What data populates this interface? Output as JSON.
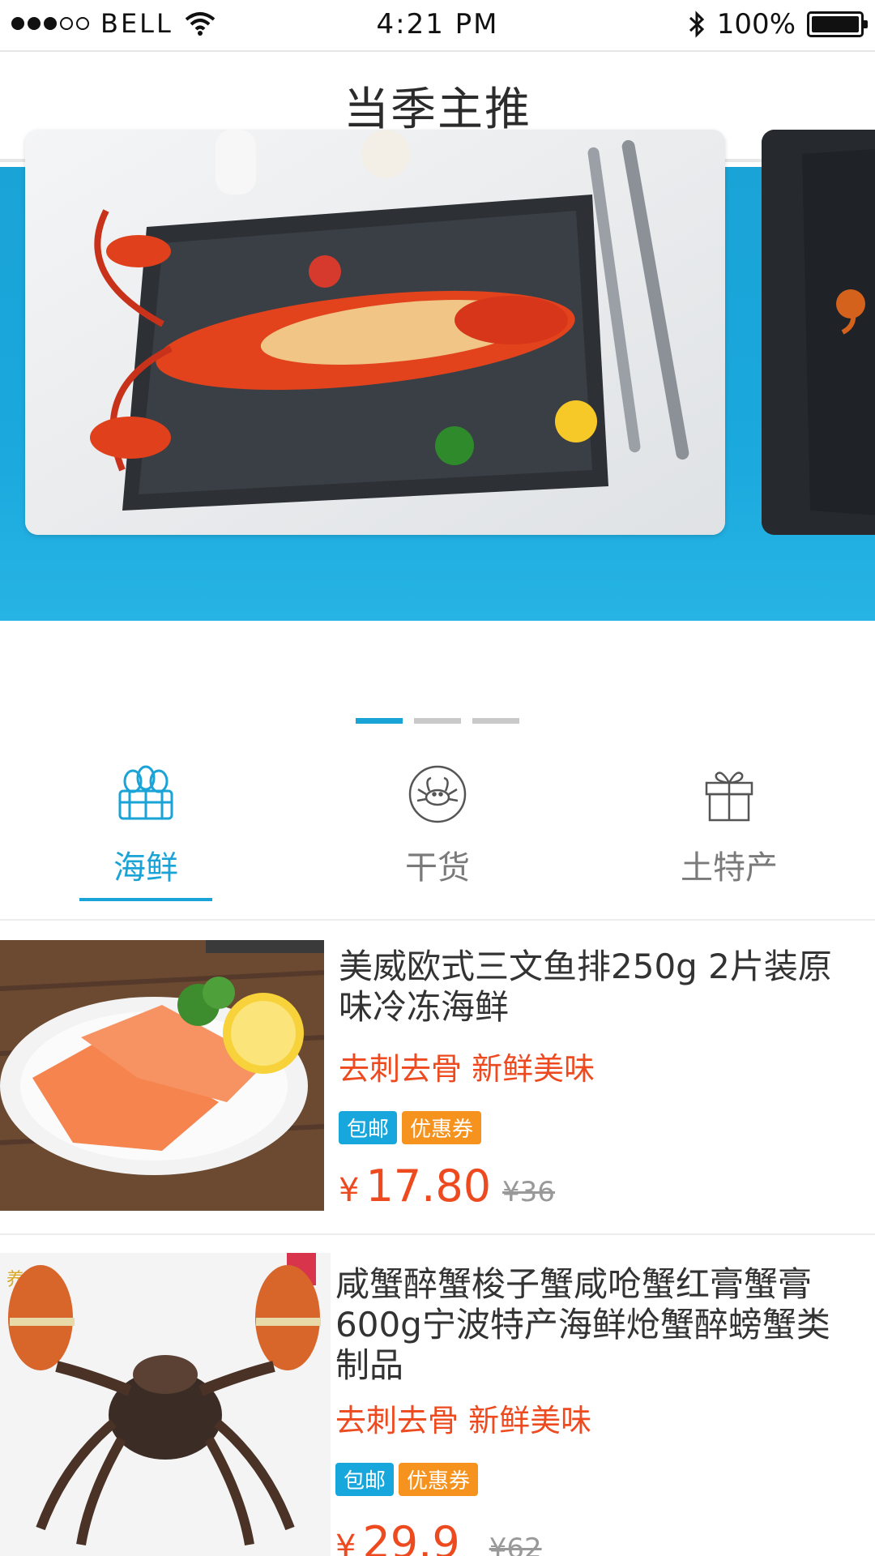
{
  "status_bar": {
    "carrier": "BELL",
    "time": "4:21 PM",
    "battery": "100%"
  },
  "nav": {
    "title": "当季主推"
  },
  "banner": {
    "pages": 3,
    "active_page": 1
  },
  "categories": [
    {
      "label": "海鲜",
      "icon": "seafood-basket-icon",
      "active": true
    },
    {
      "label": "干货",
      "icon": "crab-icon",
      "active": false
    },
    {
      "label": "土特产",
      "icon": "gift-icon",
      "active": false
    }
  ],
  "colors": {
    "accent": "#1aa3d6",
    "price": "#ee4a1f",
    "badge_blue": "#17a7dd",
    "badge_orange": "#f5931e"
  },
  "products": [
    {
      "title": "美威欧式三文鱼排250g 2片装原味冷冻海鲜",
      "tagline": "去刺去骨 新鲜美味",
      "badges": [
        "包邮",
        "优惠券"
      ],
      "currency": "¥",
      "price": "17.80",
      "old_price": "¥36"
    },
    {
      "title": "咸蟹醉蟹梭子蟹咸呛蟹红膏蟹膏600g宁波特产海鲜炝蟹醉螃蟹类制品",
      "tagline": "去刺去骨 新鲜美味",
      "badges": [
        "包邮",
        "优惠券"
      ],
      "currency": "¥",
      "price": "29.9",
      "old_price": "¥62"
    }
  ]
}
